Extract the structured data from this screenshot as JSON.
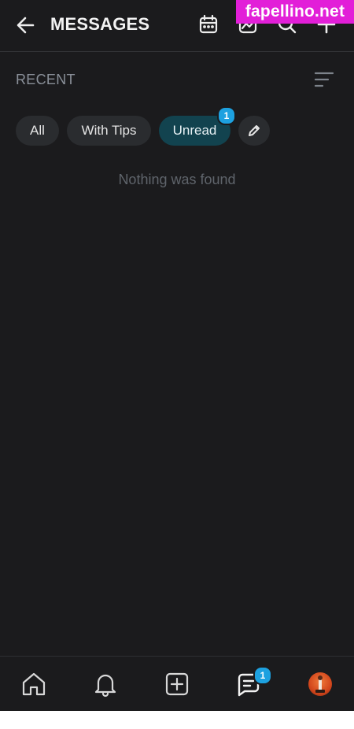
{
  "header": {
    "title": "MESSAGES"
  },
  "watermark": "fapellino.net",
  "recent": {
    "label": "RECENT"
  },
  "filters": [
    {
      "label": "All"
    },
    {
      "label": "With Tips"
    },
    {
      "label": "Unread",
      "badge": "1",
      "active": true
    }
  ],
  "empty_state": "Nothing was found",
  "bottom_nav": {
    "messages_badge": "1"
  },
  "colors": {
    "background": "#1b1b1d",
    "accent": "#1da1e0",
    "active_chip": "#12434f",
    "watermark": "#e21fd8"
  }
}
